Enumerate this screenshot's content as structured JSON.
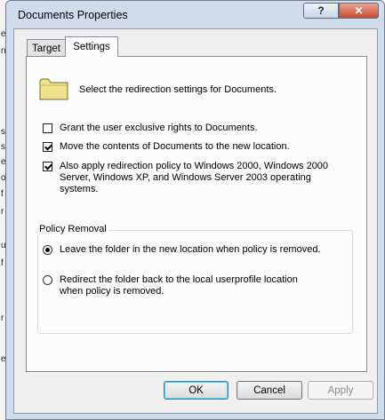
{
  "background": {
    "glyphs": [
      "e",
      "n",
      "s",
      "s",
      "e",
      "o",
      "f",
      "r",
      "u",
      "f",
      "r",
      "e"
    ]
  },
  "window": {
    "title": "Documents Properties",
    "help_glyph": "?",
    "close_glyph": "✕"
  },
  "tabs": [
    {
      "label": "Target"
    },
    {
      "label": "Settings"
    }
  ],
  "settings": {
    "header": "Select the redirection settings for Documents.",
    "options": [
      {
        "label": "Grant the user exclusive rights to Documents.",
        "checked": false
      },
      {
        "label": "Move the contents of Documents to the new location.",
        "checked": true
      },
      {
        "label": "Also apply redirection policy to Windows 2000, Windows 2000 Server, Windows XP, and Windows Server 2003 operating systems.",
        "checked": true
      }
    ],
    "policy_removal": {
      "title": "Policy Removal",
      "options": [
        {
          "label": "Leave the folder in the new location when policy is removed.",
          "selected": true
        },
        {
          "label": "Redirect the folder back to the local userprofile location when policy is removed.",
          "selected": false
        }
      ]
    }
  },
  "buttons": {
    "ok": "OK",
    "cancel": "Cancel",
    "apply": "Apply"
  },
  "colors": {
    "frame": "#cfdcea",
    "close": "#c84b33",
    "panel": "#fcfcfc"
  }
}
